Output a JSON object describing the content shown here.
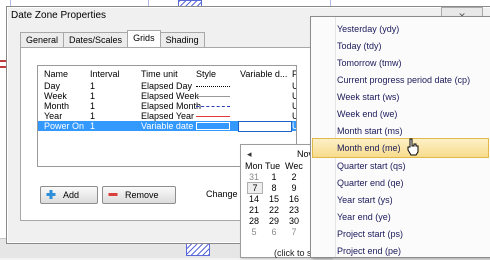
{
  "window": {
    "title": "Date Zone Properties",
    "close_glyph": "✕"
  },
  "tabs": [
    {
      "label": "General"
    },
    {
      "label": "Dates/Scales"
    },
    {
      "label": "Grids",
      "active": true
    },
    {
      "label": "Shading"
    }
  ],
  "grid": {
    "columns": [
      "Name",
      "Interval",
      "Time unit",
      "Style",
      "Variable d...",
      "Po"
    ],
    "rows": [
      {
        "name": "Day",
        "interval": "1",
        "unit": "Elapsed Day",
        "style": "dotted-black",
        "po": "Unc"
      },
      {
        "name": "Week",
        "interval": "1",
        "unit": "Elapsed Week",
        "style": "solid-gray",
        "po": "Unc"
      },
      {
        "name": "Month",
        "interval": "1",
        "unit": "Elapsed Month",
        "style": "dashdot-blue",
        "po": "Unc"
      },
      {
        "name": "Year",
        "interval": "1",
        "unit": "Elapsed Year",
        "style": "solid-red",
        "po": "Unc"
      },
      {
        "name": "Power On",
        "interval": "1",
        "unit": "Variable date",
        "style": "solid-white",
        "po": "Unc",
        "selected": true
      }
    ]
  },
  "buttons": {
    "add": "Add",
    "remove": "Remove"
  },
  "change_label": "Change",
  "calendar": {
    "nav_prev": "◂",
    "month_label": "Nov",
    "weekdays": [
      "Mon",
      "Tue",
      "Wec"
    ],
    "weeks": [
      [
        "31",
        "1",
        "2"
      ],
      [
        "7",
        "8",
        "9"
      ],
      [
        "14",
        "15",
        "16"
      ],
      [
        "21",
        "22",
        "23"
      ],
      [
        "28",
        "29",
        "30"
      ],
      [
        "5",
        "6",
        "7"
      ]
    ],
    "hint": "(click to select variable date)"
  },
  "menu": {
    "items": [
      {
        "label": "Yesterday (ydy)"
      },
      {
        "label": "Today (tdy)"
      },
      {
        "label": "Tomorrow (tmw)"
      },
      {
        "label": "Current progress period date (cp)"
      },
      {
        "label": "Week start (ws)"
      },
      {
        "label": "Week end (we)"
      },
      {
        "label": "Month start (ms)"
      },
      {
        "label": "Month end (me)",
        "hover": true
      },
      {
        "label": "Quarter start (qs)"
      },
      {
        "label": "Quarter end (qe)"
      },
      {
        "label": "Year start (ys)"
      },
      {
        "label": "Year end (ye)"
      },
      {
        "label": "Project start (ps)"
      },
      {
        "label": "Project end (pe)"
      }
    ]
  },
  "colors": {
    "selection": "#3399ff",
    "menu_hover": "#f8dc8c",
    "remove_icon": "#d9413a",
    "add_icon": "#2e8fd8"
  },
  "bottom_value": "16"
}
